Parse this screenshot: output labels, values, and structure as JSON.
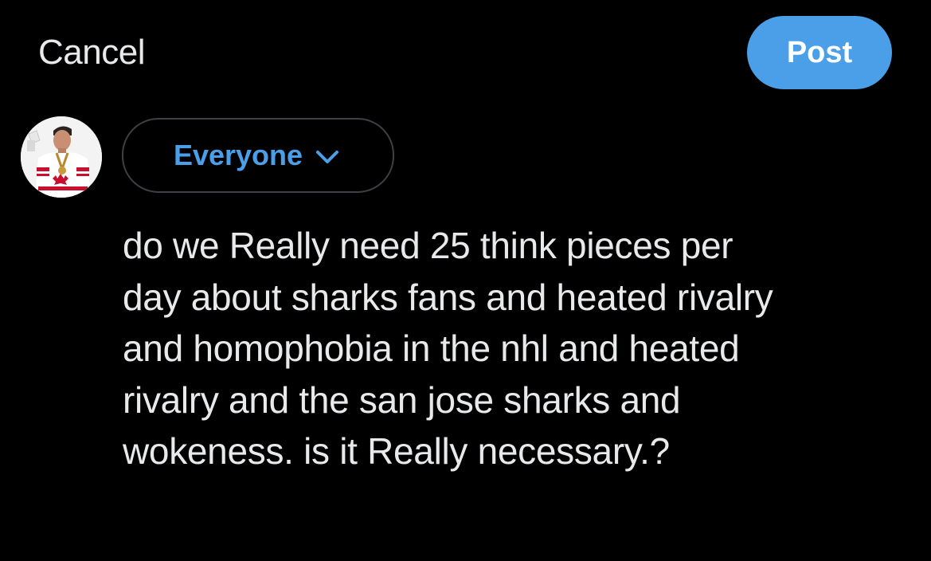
{
  "header": {
    "cancel_label": "Cancel",
    "post_label": "Post"
  },
  "composer": {
    "audience_label": "Everyone",
    "post_text": "do we Really need 25 think pieces per\nday about sharks fans and heated rivalry\nand homophobia in the nhl and heated\nrivalry and the san jose sharks and\nwokeness. is it Really necessary.?"
  },
  "colors": {
    "accent": "#4a9fe8",
    "background": "#000000",
    "text": "#e7e9ea",
    "border": "#3e4144"
  },
  "icons": {
    "audience_dropdown": "chevron-down-icon"
  }
}
